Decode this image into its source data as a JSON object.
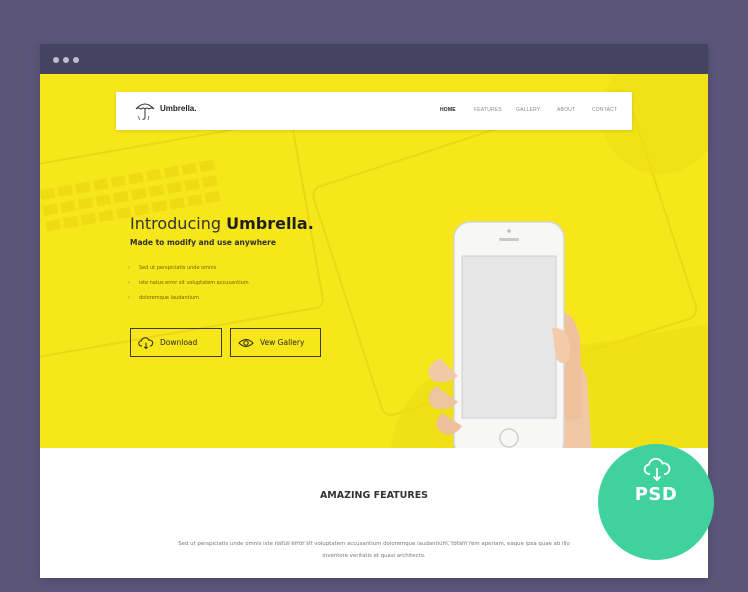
{
  "colors": {
    "page_background": "#5b557a",
    "titlebar": "#454460",
    "hero_yellow": "#f6e61a",
    "badge_green": "#3fd29f"
  },
  "navbar": {
    "logo_text": "Umbrella.",
    "logo_icon": "umbrella-icon",
    "links": [
      "HOME",
      "FEATURES",
      "GALLERY",
      "ABOUT",
      "CONTACT"
    ]
  },
  "hero": {
    "title_light": "Introducing ",
    "title_bold": "Umbrella.",
    "subtitle": "Made to modify and use anywhere",
    "features": [
      "Sed ut perspiciatis unde omnis",
      "iste natus error sit voluptatem accusantium",
      "doloremque laudantium"
    ],
    "buttons": {
      "download": "Download",
      "gallery": "Vew Gallery"
    }
  },
  "features_section": {
    "title": "AMAZING FEATURES",
    "text": "Sed ut perspiciatis unde omnis iste natus error sit voluptatem accusantium doloremque laudantium, totam rem aperiam, eaque ipsa quae ab illo inventore veritatis et quasi architecto."
  },
  "badge": {
    "label": "PSD",
    "icon": "cloud-download-icon"
  }
}
